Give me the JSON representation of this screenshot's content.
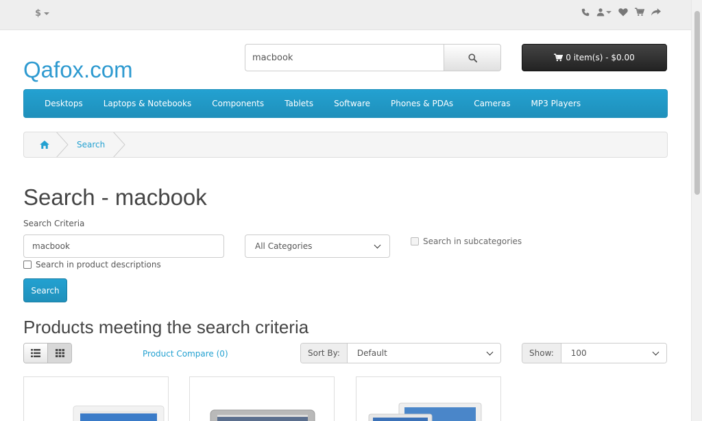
{
  "topbar": {
    "currency_symbol": "$",
    "icons": [
      "phone-icon",
      "user-icon",
      "heart-icon",
      "cart-icon",
      "share-icon"
    ]
  },
  "header": {
    "logo": "Qafox.com",
    "search_value": "macbook",
    "cart_label": "0 item(s) - $0.00"
  },
  "menu": {
    "items": [
      "Desktops",
      "Laptops & Notebooks",
      "Components",
      "Tablets",
      "Software",
      "Phones & PDAs",
      "Cameras",
      "MP3 Players"
    ]
  },
  "breadcrumb": {
    "current": "Search"
  },
  "main": {
    "title": "Search - macbook",
    "criteria_label": "Search Criteria",
    "criteria_value": "macbook",
    "category_selected": "All Categories",
    "subcategories_label": "Search in subcategories",
    "descriptions_label": "Search in product descriptions",
    "search_button": "Search",
    "products_title": "Products meeting the search criteria",
    "compare_link": "Product Compare (0)",
    "sort_label": "Sort By:",
    "sort_selected": "Default",
    "show_label": "Show:",
    "show_selected": "100"
  },
  "colors": {
    "brand": "#23a1d1",
    "cart_button": "#333333"
  }
}
